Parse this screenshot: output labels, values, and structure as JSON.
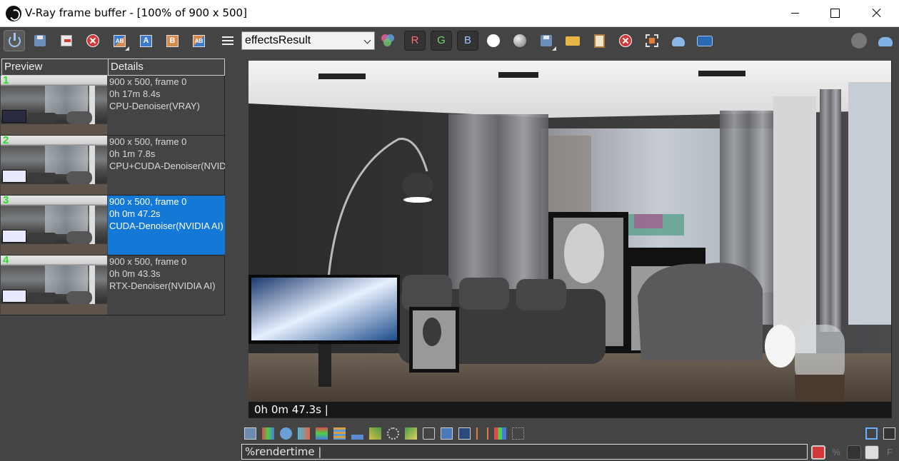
{
  "window": {
    "title": "V-Ray frame buffer - [100% of 900 x 500]"
  },
  "toolbar": {
    "channel_selected": "effectsResult",
    "red_channel_label": "R",
    "green_channel_label": "G",
    "blue_channel_label": "B",
    "compare_a_label": "A",
    "compare_b_label": "B",
    "compare_ab_label": "AB"
  },
  "history": {
    "columns": [
      "Preview",
      "Details"
    ],
    "items": [
      {
        "index": "1",
        "resolution": "900 x 500, frame 0",
        "time": "0h 17m 8.4s",
        "label": "CPU-Denoiser(VRAY)",
        "selected": false
      },
      {
        "index": "2",
        "resolution": "900 x 500, frame 0",
        "time": "0h 1m 7.8s",
        "label": "CPU+CUDA-Denoiser(NVIDIA AI)",
        "selected": false
      },
      {
        "index": "3",
        "resolution": "900 x 500, frame 0",
        "time": "0h 0m 47.2s",
        "label": "CUDA-Denoiser(NVIDIA AI)",
        "selected": true
      },
      {
        "index": "4",
        "resolution": "900 x 500, frame 0",
        "time": "0h 0m 43.3s",
        "label": "RTX-Denoiser(NVIDIA AI)",
        "selected": false
      }
    ]
  },
  "render": {
    "stamp_text": "0h  0m 47.3s |"
  },
  "bottom": {
    "stamp_template": "%rendertime |"
  }
}
